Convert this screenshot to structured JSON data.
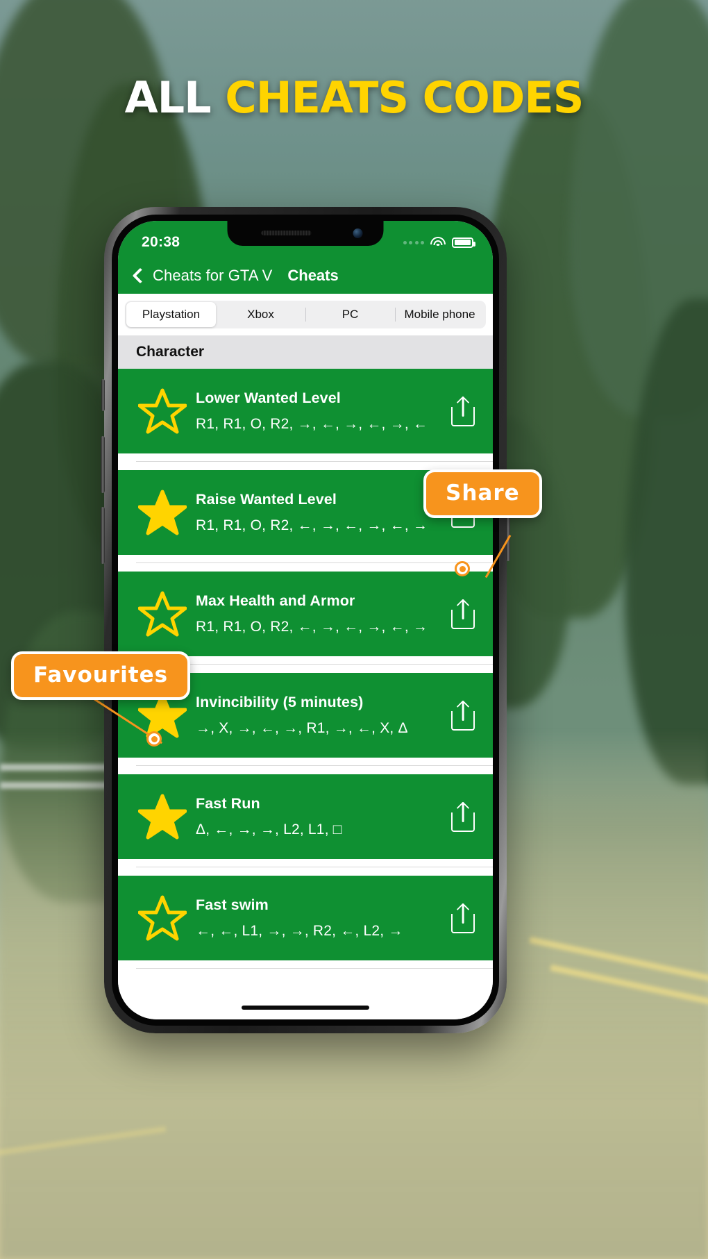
{
  "headline": {
    "white": "ALL ",
    "yellow": "CHEATS CODES"
  },
  "colors": {
    "brand_green": "#0f9032",
    "accent_orange": "#f7941d",
    "star_yellow": "#ffd400",
    "headline_yellow": "#ffd400"
  },
  "status_bar": {
    "time": "20:38",
    "wifi_icon": "wifi-icon",
    "battery_icon": "battery-icon",
    "signal_icon": "signal-dots-icon"
  },
  "navbar": {
    "back_label": "Cheats for GTA V",
    "title": "Cheats",
    "back_icon": "chevron-left-icon"
  },
  "segmented": {
    "options": [
      "Playstation",
      "Xbox",
      "PC",
      "Mobile phone"
    ],
    "selected": "Playstation"
  },
  "section": {
    "title": "Character"
  },
  "list": [
    {
      "title": "Lower Wanted Level",
      "code": "R1, R1, O, R2, →, ←, →, ←, →, ←",
      "favourite": false,
      "share_icon": "share-icon",
      "star_icon": "star-icon"
    },
    {
      "title": "Raise Wanted Level",
      "code": "R1, R1, O, R2, ←, →, ←, →, ←, →",
      "favourite": true,
      "share_icon": "share-icon",
      "star_icon": "star-icon"
    },
    {
      "title": "Max Health and Armor",
      "code": "R1, R1, O, R2, ←, →, ←, →, ←, →",
      "favourite": false,
      "share_icon": "share-icon",
      "star_icon": "star-icon"
    },
    {
      "title": "Invincibility (5 minutes)",
      "code": "→, X, →, ←, →, R1, →, ←, X, Δ",
      "favourite": true,
      "share_icon": "share-icon",
      "star_icon": "star-icon"
    },
    {
      "title": "Fast Run",
      "code": "Δ, ←, →, →, L2, L1, □",
      "favourite": true,
      "share_icon": "share-icon",
      "star_icon": "star-icon"
    },
    {
      "title": "Fast swim",
      "code": "←, ←, L1, →, →, R2, ←, L2, →",
      "favourite": false,
      "share_icon": "share-icon",
      "star_icon": "star-icon"
    }
  ],
  "callouts": [
    {
      "label": "Share",
      "name": "callout-share"
    },
    {
      "label": "Favourites",
      "name": "callout-favourites"
    }
  ]
}
